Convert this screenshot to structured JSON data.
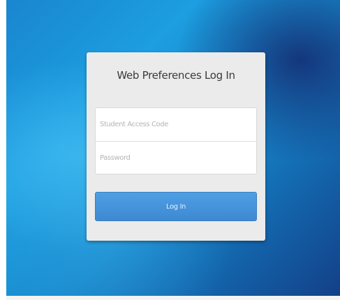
{
  "login": {
    "title": "Web Preferences Log In",
    "access_code_placeholder": "Student Access Code",
    "access_code_value": "",
    "password_placeholder": "Password",
    "password_value": "",
    "login_button_label": "Log In"
  },
  "colors": {
    "background_light": "#1c9ee0",
    "background_dark": "#133f86",
    "panel": "#ebebeb",
    "button": "#4590d8"
  }
}
